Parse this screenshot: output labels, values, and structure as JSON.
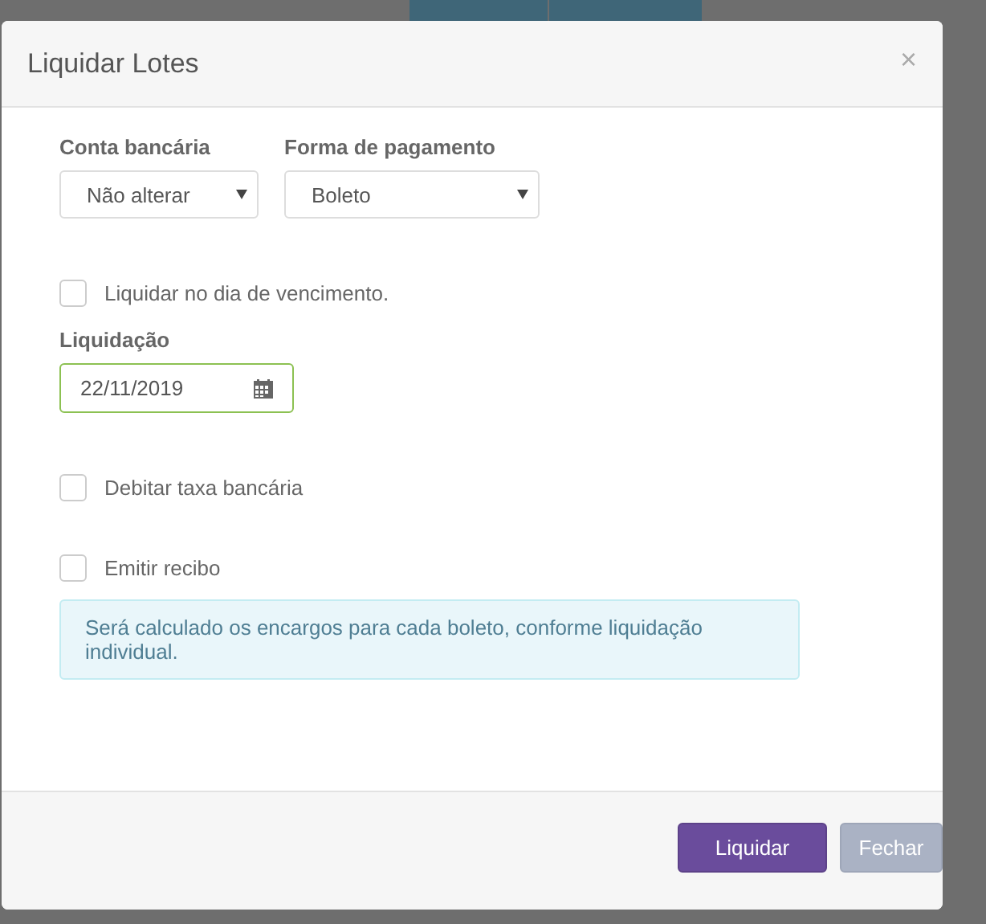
{
  "modal": {
    "title": "Liquidar Lotes",
    "close": "×"
  },
  "selects": [
    {
      "label": "Conta bancária",
      "value": "Não alterar"
    },
    {
      "label": "Forma de pagamento",
      "value": "Boleto"
    }
  ],
  "due_date_checkbox": {
    "label": "Liquidar no dia de vencimento.",
    "checked": false
  },
  "settlement_date": {
    "label": "Liquidação",
    "value": "22/11/2019"
  },
  "options": [
    {
      "label": "Debitar taxa bancária",
      "checked": false
    },
    {
      "label": "Emitir recibo",
      "checked": false
    }
  ],
  "alert": "Será calculado os encargos para cada boleto, conforme liquidação individual.",
  "buttons": [
    {
      "label": "Liquidar",
      "kind": "primary"
    },
    {
      "label": "Fechar",
      "kind": "secondary"
    }
  ]
}
